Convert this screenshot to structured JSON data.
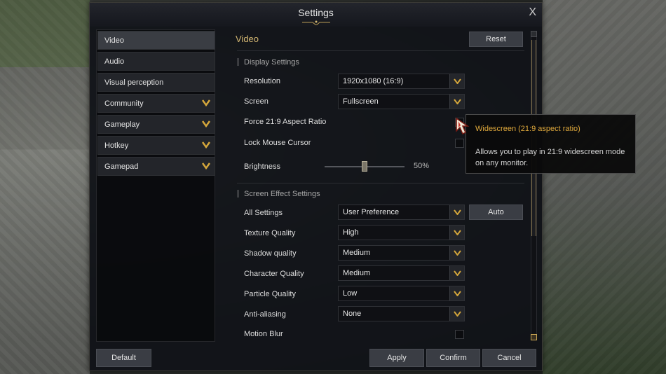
{
  "window": {
    "title": "Settings",
    "close_glyph": "X"
  },
  "sidebar": {
    "items": [
      {
        "label": "Video",
        "active": true,
        "expandable": false
      },
      {
        "label": "Audio",
        "expandable": false
      },
      {
        "label": "Visual perception",
        "expandable": false
      },
      {
        "label": "Community",
        "expandable": true
      },
      {
        "label": "Gameplay",
        "expandable": true
      },
      {
        "label": "Hotkey",
        "expandable": true
      },
      {
        "label": "Gamepad",
        "expandable": true
      }
    ]
  },
  "main": {
    "section_title": "Video",
    "reset_label": "Reset",
    "display_header": "Display Settings",
    "resolution": {
      "label": "Resolution",
      "value": "1920x1080 (16:9)"
    },
    "screen": {
      "label": "Screen",
      "value": "Fullscreen"
    },
    "aspect": {
      "label": "Force 21:9 Aspect Ratio",
      "checked": false
    },
    "lock_cursor": {
      "label": "Lock Mouse Cursor",
      "checked": false
    },
    "brightness": {
      "label": "Brightness",
      "value_text": "50%",
      "value": 0.5
    },
    "effects_header": "Screen Effect Settings",
    "all_settings": {
      "label": "All Settings",
      "value": "User Preference"
    },
    "auto_label": "Auto",
    "texture": {
      "label": "Texture Quality",
      "value": "High"
    },
    "shadow": {
      "label": "Shadow quality",
      "value": "Medium"
    },
    "character": {
      "label": "Character Quality",
      "value": "Medium"
    },
    "particle": {
      "label": "Particle Quality",
      "value": "Low"
    },
    "antialias": {
      "label": "Anti-aliasing",
      "value": "None"
    },
    "motion_blur": {
      "label": "Motion Blur",
      "checked": false
    }
  },
  "footer": {
    "default_label": "Default",
    "apply_label": "Apply",
    "confirm_label": "Confirm",
    "cancel_label": "Cancel"
  },
  "tooltip": {
    "title": "Widescreen (21:9 aspect ratio)",
    "body": "Allows you to play in 21:9 widescreen mode on any monitor."
  },
  "colors": {
    "accent_gold": "#d4b873",
    "tooltip_title": "#e0a93c"
  },
  "icons": {
    "chevron": "chevron-down-icon",
    "close": "close-icon",
    "cursor": "mouse-cursor-icon"
  }
}
